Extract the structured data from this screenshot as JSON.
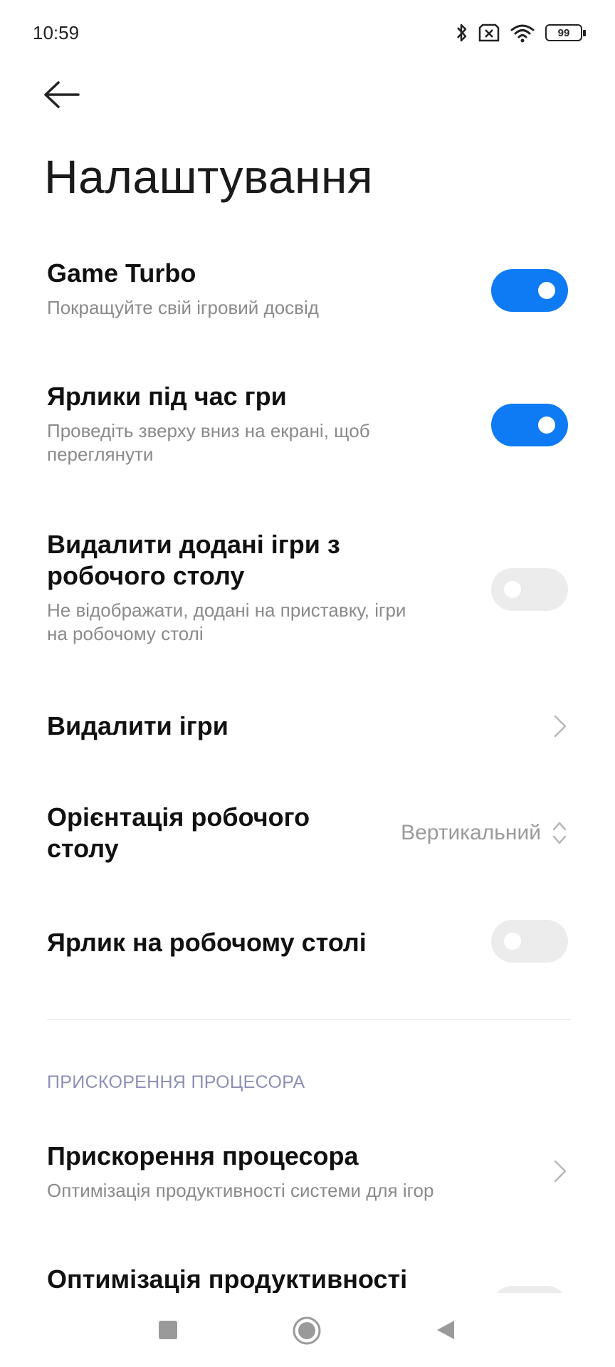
{
  "status_bar": {
    "time": "10:59",
    "battery": "99",
    "icons": [
      "bluetooth-icon",
      "sim-disabled-icon",
      "wifi-icon",
      "battery-icon"
    ]
  },
  "page": {
    "title": "Налаштування"
  },
  "settings": {
    "game_turbo": {
      "title": "Game Turbo",
      "subtitle": "Покращуйте свій ігровий досвід",
      "enabled": true
    },
    "shortcuts_in_game": {
      "title": "Ярлики під час гри",
      "subtitle_line1": "Проведіть зверху вниз на екрані, щоб",
      "subtitle_line2": "переглянути",
      "enabled": true
    },
    "remove_added_games": {
      "title_line1": "Видалити додані ігри з",
      "title_line2": "робочого столу",
      "subtitle_line1": "Не відображати, додані на приставку, ігри",
      "subtitle_line2": "на робочому столі",
      "enabled": false
    },
    "remove_games": {
      "title": "Видалити ігри"
    },
    "desktop_orientation": {
      "title_line1": "Орієнтація робочого",
      "title_line2": "столу",
      "value": "Вертикальний"
    },
    "desktop_shortcut": {
      "title": "Ярлик на робочому столі",
      "enabled": false
    }
  },
  "cpu_section": {
    "header": "ПРИСКОРЕННЯ ПРОЦЕСОРА",
    "cpu_boost": {
      "title": "Прискорення процесора",
      "subtitle": "Оптимізація продуктивності системи для ігор"
    },
    "perf_optimization": {
      "title": "Оптимізація продуктивності"
    }
  },
  "colors": {
    "accent": "#0e7bf5",
    "toggle_off": "#ececec",
    "section_header": "#8c8fb5"
  }
}
